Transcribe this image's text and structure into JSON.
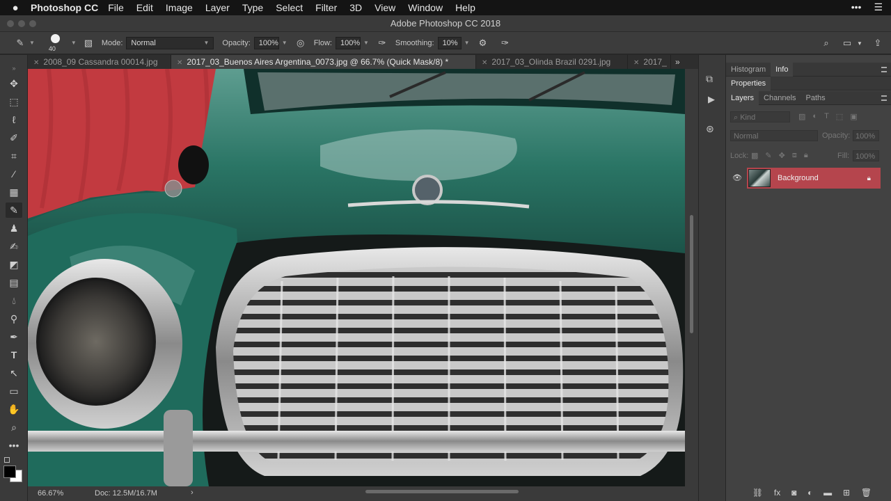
{
  "menubar": {
    "app_name": "Photoshop CC",
    "items": [
      "File",
      "Edit",
      "Image",
      "Layer",
      "Type",
      "Select",
      "Filter",
      "3D",
      "View",
      "Window",
      "Help"
    ]
  },
  "window": {
    "title": "Adobe Photoshop CC 2018"
  },
  "options": {
    "brush_size": "40",
    "mode_label": "Mode:",
    "mode_value": "Normal",
    "opacity_label": "Opacity:",
    "opacity_value": "100%",
    "flow_label": "Flow:",
    "flow_value": "100%",
    "smoothing_label": "Smoothing:",
    "smoothing_value": "10%"
  },
  "tabs": [
    {
      "label": "2008_09 Cassandra 00014.jpg"
    },
    {
      "label": "2017_03_Buenos Aires Argentina_0073.jpg @ 66.7% (Quick Mask/8) *"
    },
    {
      "label": "2017_03_Olinda Brazil 0291.jpg"
    },
    {
      "label": "2017_"
    }
  ],
  "status": {
    "zoom": "66.67%",
    "doc": "Doc: 12.5M/16.7M"
  },
  "panels": {
    "top_tabs": [
      "Histogram",
      "Info"
    ],
    "properties": "Properties",
    "layers_tabs": [
      "Layers",
      "Channels",
      "Paths"
    ],
    "kind": "Kind",
    "blend_mode": "Normal",
    "opacity_label": "Opacity:",
    "opacity_value": "100%",
    "lock_label": "Lock:",
    "fill_label": "Fill:",
    "fill_value": "100%",
    "layer_name": "Background"
  },
  "colors": {
    "accent_layer": "#b5454d",
    "car_green": "#1f6b5c",
    "background_red": "#c23a40"
  }
}
